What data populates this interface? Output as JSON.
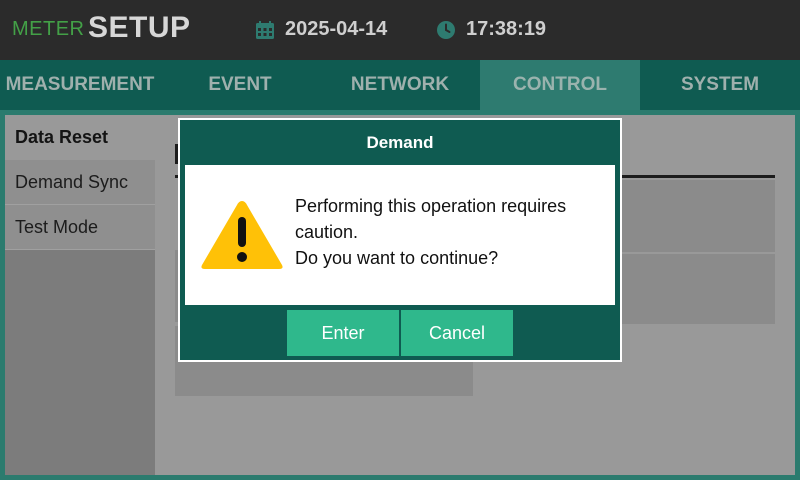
{
  "header": {
    "brand_small": "METER",
    "brand_large": "SETUP",
    "date": "2025-04-14",
    "time": "17:38:19",
    "date_icon": "calendar-icon",
    "time_icon": "clock-icon"
  },
  "tabs": [
    {
      "label": "MEASUREMENT"
    },
    {
      "label": "EVENT"
    },
    {
      "label": "NETWORK"
    },
    {
      "label": "CONTROL",
      "active": true
    },
    {
      "label": "SYSTEM"
    }
  ],
  "sidebar": {
    "items": [
      {
        "label": "Data Reset",
        "active": true
      },
      {
        "label": "Demand Sync"
      },
      {
        "label": "Test Mode"
      }
    ]
  },
  "dialog": {
    "title": "Demand",
    "message_line1": "Performing this operation requires caution.",
    "message_line2": "Do you want to continue?",
    "icon": "warning-icon",
    "enter_label": "Enter",
    "cancel_label": "Cancel"
  },
  "colors": {
    "brand_green": "#43a047",
    "tab_bar": "#0f5b51",
    "tab_active": "#2e7b70",
    "button": "#2fb88c",
    "warning": "#ffc107"
  }
}
